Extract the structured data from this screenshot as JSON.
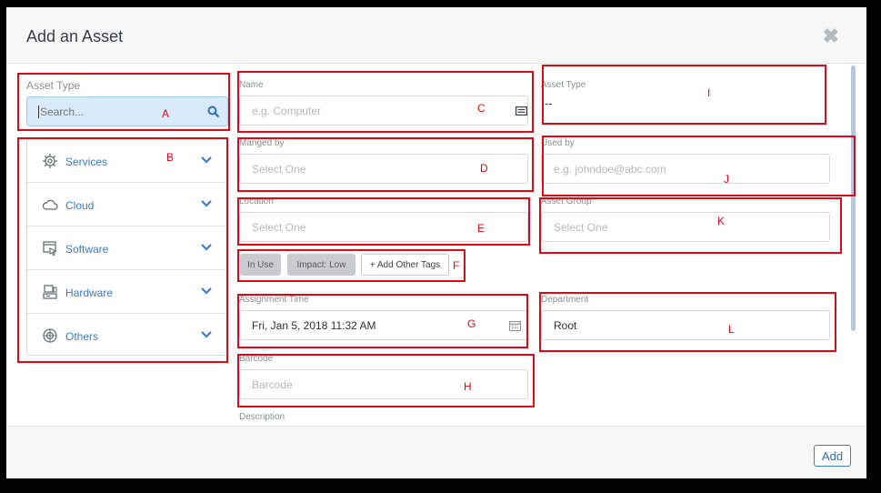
{
  "modal": {
    "title": "Add an Asset",
    "close_icon": "close-icon"
  },
  "left": {
    "asset_type_label": "Asset Type",
    "search_placeholder": "Search...",
    "categories": [
      {
        "label": "Services",
        "icon": "services-icon"
      },
      {
        "label": "Cloud",
        "icon": "cloud-icon"
      },
      {
        "label": "Software",
        "icon": "software-icon"
      },
      {
        "label": "Hardware",
        "icon": "hardware-icon"
      },
      {
        "label": "Others",
        "icon": "others-icon"
      }
    ]
  },
  "fields": {
    "name": {
      "label": "Name",
      "placeholder": "e.g. Computer"
    },
    "managed_by": {
      "label": "Manged by",
      "placeholder": "Select One"
    },
    "location": {
      "label": "Location",
      "placeholder": "Select One"
    },
    "tags": [
      "In Use",
      "Impact: Low",
      "+ Add Other Tags"
    ],
    "assignment_time": {
      "label": "Assignment Time",
      "value": "Fri, Jan 5, 2018 11:32 AM"
    },
    "barcode": {
      "label": "Barcode",
      "placeholder": "Barcode"
    },
    "description": {
      "label": "Description"
    },
    "asset_type": {
      "label": "Asset Type",
      "value": "--"
    },
    "used_by": {
      "label": "Used by",
      "placeholder": "e.g. johndoe@abc.com"
    },
    "asset_group": {
      "label": "Asset Group",
      "placeholder": "Select One"
    },
    "department": {
      "label": "Department",
      "value": "Root"
    }
  },
  "annotations": [
    "A",
    "B",
    "C",
    "D",
    "E",
    "F",
    "G",
    "H",
    "I",
    "J",
    "K",
    "L"
  ],
  "footer": {
    "add_label": "Add"
  },
  "colors": {
    "annotation": "#e30613",
    "accent": "#3d7cc4",
    "search_bg": "#d9ebf9"
  }
}
